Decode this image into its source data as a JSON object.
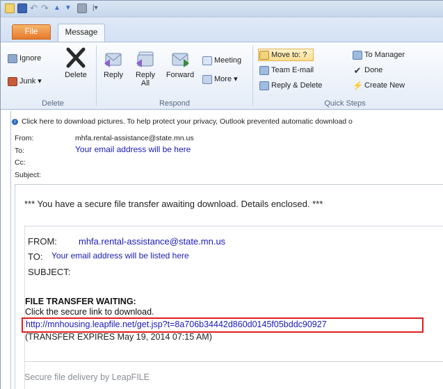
{
  "ribbon": {
    "tabs": {
      "file": "File",
      "message": "Message"
    },
    "delete_group": {
      "label": "Delete",
      "ignore": "Ignore",
      "junk": "Junk ▾",
      "delete": "Delete"
    },
    "respond_group": {
      "label": "Respond",
      "reply": "Reply",
      "reply_all": "Reply All",
      "forward": "Forward",
      "meeting": "Meeting",
      "more": "More ▾"
    },
    "quick_steps_group": {
      "label": "Quick Steps",
      "move_to": "Move to: ?",
      "team_email": "Team E-mail",
      "reply_delete": "Reply & Delete",
      "to_manager": "To Manager",
      "done": "Done",
      "create_new": "Create New"
    }
  },
  "infobar": {
    "text": "Click here to download pictures. To help protect your privacy, Outlook prevented automatic download o"
  },
  "header": {
    "from_label": "From:",
    "from_value": "mhfa.rental-assistance@state.mn.us",
    "to_label": "To:",
    "to_value": "Your email address will be here",
    "cc_label": "Cc:",
    "subject_label": "Subject:"
  },
  "message": {
    "notice": "*** You have a secure file transfer awaiting download. Details enclosed. ***",
    "from_label": "FROM:",
    "from_value": "mhfa.rental-assistance@state.mn.us",
    "to_label": "TO:",
    "to_value": "Your email address will be listed here",
    "subject_label": "SUBJECT:",
    "ft_title": "FILE TRANSFER WAITING:",
    "ft_click": "Click the secure link to download.",
    "ft_link": "http://mnhousing.leapfile.net/get.jsp?t=8a706b34442d860d0145f05bddc90927",
    "ft_expire": "(TRANSFER EXPIRES May 19, 2014 07:15 AM)",
    "footer": "Secure file delivery by LeapFILE"
  },
  "colors": {
    "link": "#1a1ab4",
    "highlight_box": "#e01d1d",
    "file_tab": "#e5782b"
  },
  "icons": [
    "envelope-icon",
    "save-icon",
    "undo-icon",
    "redo-icon",
    "up-icon",
    "down-icon",
    "print-icon",
    "ignore-icon",
    "junk-icon",
    "delete-x-icon",
    "reply-icon",
    "reply-all-icon",
    "forward-icon",
    "meeting-icon",
    "more-icon",
    "move-to-icon",
    "team-email-icon",
    "reply-delete-icon",
    "to-manager-icon",
    "done-check-icon",
    "create-new-icon",
    "info-icon"
  ]
}
